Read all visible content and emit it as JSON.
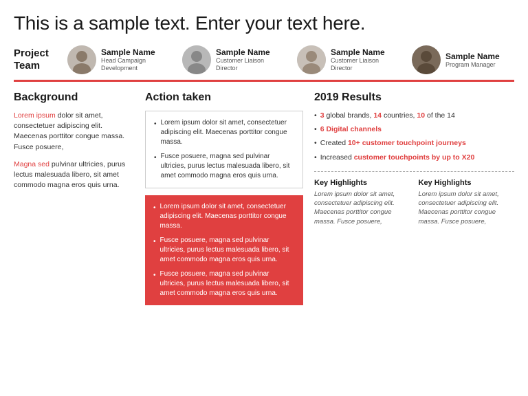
{
  "header": {
    "title": "This is a sample text. Enter your text here."
  },
  "projectTeam": {
    "label": "Project\nTeam",
    "members": [
      {
        "name": "Sample Name",
        "role": "Head Campaign Development"
      },
      {
        "name": "Sample Name",
        "role": "Customer Liaison Director"
      },
      {
        "name": "Sample Name",
        "role": "Customer Liaison Director"
      },
      {
        "name": "Sample Name",
        "role": "Program Manager"
      }
    ]
  },
  "background": {
    "title": "Background",
    "block1_highlight": "Lorem ipsum",
    "block1_text": " dolor sit amet, consectetuer adipiscing elit. Maecenas porttitor congue massa. Fusce posuere,",
    "block2_highlight": "Magna sed",
    "block2_text": " pulvinar ultricies, purus lectus malesuada libero, sit amet commodo magna eros quis urna."
  },
  "action": {
    "title": "Action taken",
    "whitebox": [
      "Lorem ipsum dolor sit amet, consectetuer adipiscing elit. Maecenas porttitor congue massa.",
      "Fusce posuere, magna sed pulvinar ultricies, purus lectus malesuada libero, sit amet commodo magna eros quis urna."
    ],
    "redbox": [
      "Lorem ipsum dolor sit amet, consectetuer adipiscing elit. Maecenas porttitor congue massa.",
      "Fusce posuere, magna sed pulvinar ultricies, purus lectus malesuada libero, sit amet commodo magna eros quis urna.",
      "Fusce posuere, magna sed pulvinar ultricies, purus lectus malesuada libero, sit amet commodo magna eros quis urna."
    ]
  },
  "results": {
    "title": "2019 Results",
    "items": [
      {
        "text": " global brands, ",
        "highlights": [
          "3",
          "14",
          "10"
        ],
        "full": "3 global brands, 14 countries, 10 of the 14"
      },
      {
        "full": "6 Digital channels",
        "highlights": [
          "6 Digital channels"
        ]
      },
      {
        "full": "Created 10+ customer touchpoint journeys",
        "highlights": [
          "10+ customer touchpoint journeys"
        ]
      },
      {
        "full": "Increased customer touchpoints by up to X20",
        "highlights": [
          "customer touchpoints by up to X20"
        ]
      }
    ],
    "keyHighlights": [
      {
        "title": "Key Highlights",
        "text": "Lorem ipsum dolor sit amet, consectetuer adipiscing elit. Maecenas porttitor congue massa. Fusce posuere,"
      },
      {
        "title": "Key Highlights",
        "text": "Lorem ipsum dolor sit amet, consectetuer adipiscing elit. Maecenas porttitor congue massa. Fusce posuere,"
      }
    ]
  }
}
